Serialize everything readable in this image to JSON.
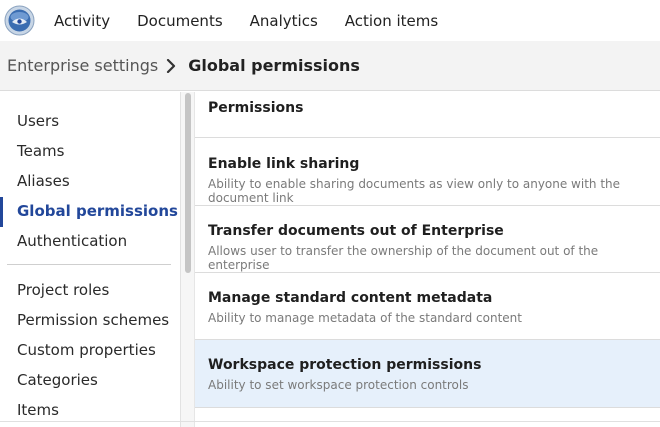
{
  "nav": {
    "items": [
      {
        "label": "Activity"
      },
      {
        "label": "Documents"
      },
      {
        "label": "Analytics"
      },
      {
        "label": "Action items"
      }
    ]
  },
  "breadcrumb": {
    "parent": "Enterprise settings",
    "current": "Global permissions"
  },
  "sidebar": {
    "group1": [
      {
        "label": "Users"
      },
      {
        "label": "Teams"
      },
      {
        "label": "Aliases"
      },
      {
        "label": "Global permissions"
      },
      {
        "label": "Authentication"
      }
    ],
    "group2": [
      {
        "label": "Project roles"
      },
      {
        "label": "Permission schemes"
      },
      {
        "label": "Custom properties"
      },
      {
        "label": "Categories"
      },
      {
        "label": "Items"
      }
    ]
  },
  "main": {
    "header": "Permissions",
    "permissions": [
      {
        "title": "Enable link sharing",
        "description": "Ability to enable sharing documents as view only to anyone with the document link"
      },
      {
        "title": "Transfer documents out of Enterprise",
        "description": "Allows user to transfer the ownership of the document out of the enterprise"
      },
      {
        "title": "Manage standard content metadata",
        "description": "Ability to manage metadata of the standard content"
      },
      {
        "title": "Workspace protection permissions",
        "description": "Ability to set workspace protection controls"
      }
    ]
  },
  "colors": {
    "accent": "#22479a",
    "selected_row": "#e6f0fb",
    "breadcrumb_bg": "#f3f3f3"
  },
  "icons": {
    "logo": "onshape-logo-icon",
    "breadcrumb_separator": "chevron-right-icon"
  }
}
